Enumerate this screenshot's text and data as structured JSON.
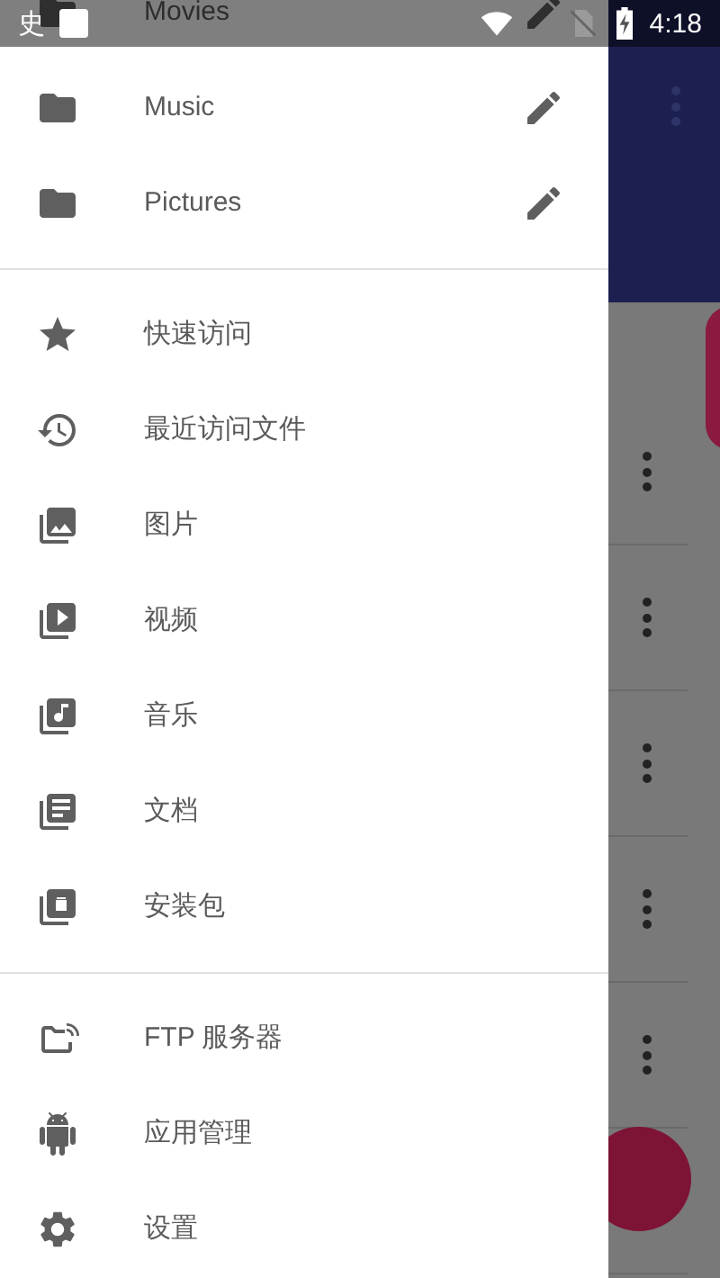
{
  "status_bar": {
    "notification_glyph": "史",
    "time": "4:18"
  },
  "drawer": {
    "bookmarks": [
      {
        "label": "Movies"
      },
      {
        "label": "Music"
      },
      {
        "label": "Pictures"
      }
    ],
    "categories": [
      {
        "label": "快速访问"
      },
      {
        "label": "最近访问文件"
      },
      {
        "label": "图片"
      },
      {
        "label": "视频"
      },
      {
        "label": "音乐"
      },
      {
        "label": "文档"
      },
      {
        "label": "安装包"
      }
    ],
    "tools": [
      {
        "label": "FTP 服务器"
      },
      {
        "label": "应用管理"
      },
      {
        "label": "设置"
      }
    ]
  }
}
